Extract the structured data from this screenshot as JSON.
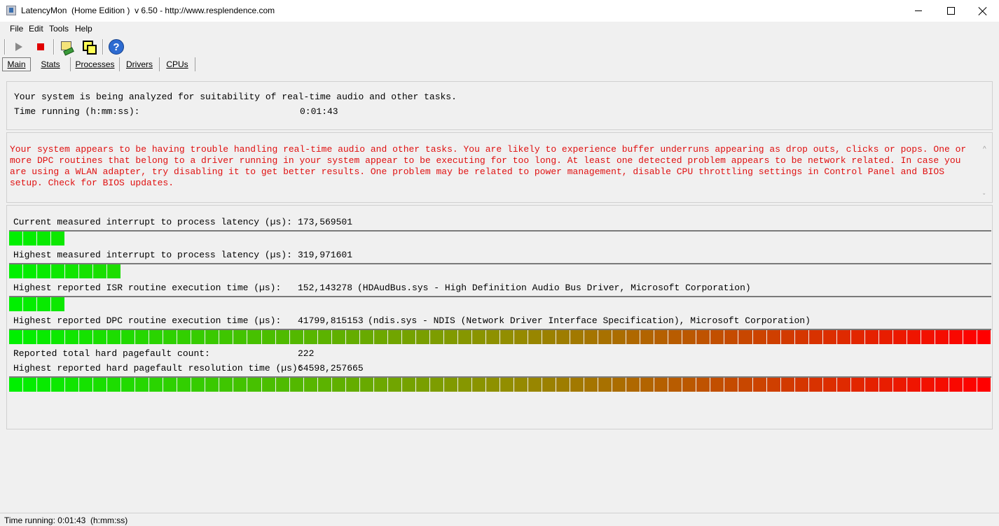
{
  "window": {
    "title": "LatencyMon  (Home Edition )  v 6.50 - http://www.resplendence.com",
    "icon": "latencymon-app-icon"
  },
  "menu": [
    "File",
    "Edit",
    "Tools",
    "Help"
  ],
  "toolbar": {
    "icons": [
      "play-icon",
      "stop-icon",
      "cpu-icon",
      "windows-icon",
      "help-icon"
    ],
    "help_glyph": "?"
  },
  "tabs": [
    {
      "label": "Main",
      "active": true
    },
    {
      "label": "Stats",
      "active": false
    },
    {
      "label": "Processes",
      "active": false
    },
    {
      "label": "Drivers",
      "active": false
    },
    {
      "label": "CPUs",
      "active": false
    }
  ],
  "status_panel": {
    "analyzing_message": "Your system is being analyzed for suitability of real-time audio and other tasks.",
    "time_label": "Time running (h:mm:ss):",
    "time_value": "0:01:43"
  },
  "warning_text": "Your system appears to be having trouble handling real-time audio and other tasks. You are likely to experience buffer underruns appearing as drop outs, clicks or pops. One or more DPC routines that belong to a driver running in your system appear to be executing for too long. At least one detected problem appears to be network related. In case you are using a WLAN adapter, try disabling it to get better results. One problem may be related to power management, disable CPU throttling settings in Control Panel and BIOS setup. Check for BIOS updates.",
  "meter_total_segments": 70,
  "metrics": [
    {
      "label": "Current measured interrupt to process latency (µs):",
      "value": "173,569501",
      "detail": "",
      "lit_segments": 4
    },
    {
      "label": "Highest measured interrupt to process latency (µs):",
      "value": "319,971601",
      "detail": "",
      "lit_segments": 8
    },
    {
      "label": "Highest reported ISR routine execution time (µs):",
      "value": "152,143278",
      "detail": "(HDAudBus.sys - High Definition Audio Bus Driver, Microsoft Corporation)",
      "lit_segments": 4
    },
    {
      "label": "Highest reported DPC routine execution time (µs):",
      "value": "41799,815153",
      "detail": "(ndis.sys - NDIS (Network Driver Interface Specification), Microsoft Corporation)",
      "lit_segments": 70
    }
  ],
  "pagefault": {
    "count_label": "Reported total hard pagefault count:",
    "count_value": "222",
    "time_label": "Highest reported hard pagefault resolution time (µs):",
    "time_value": "64598,257665",
    "lit_segments": 70
  },
  "statusbar": {
    "text": "Time running: 0:01:43  (h:mm:ss)"
  },
  "colors": {
    "warning": "#e01010",
    "meter_start": "#00f000",
    "meter_mid": "#909000",
    "meter_end": "#ff0000",
    "meter_border": "#7a7a7a"
  }
}
